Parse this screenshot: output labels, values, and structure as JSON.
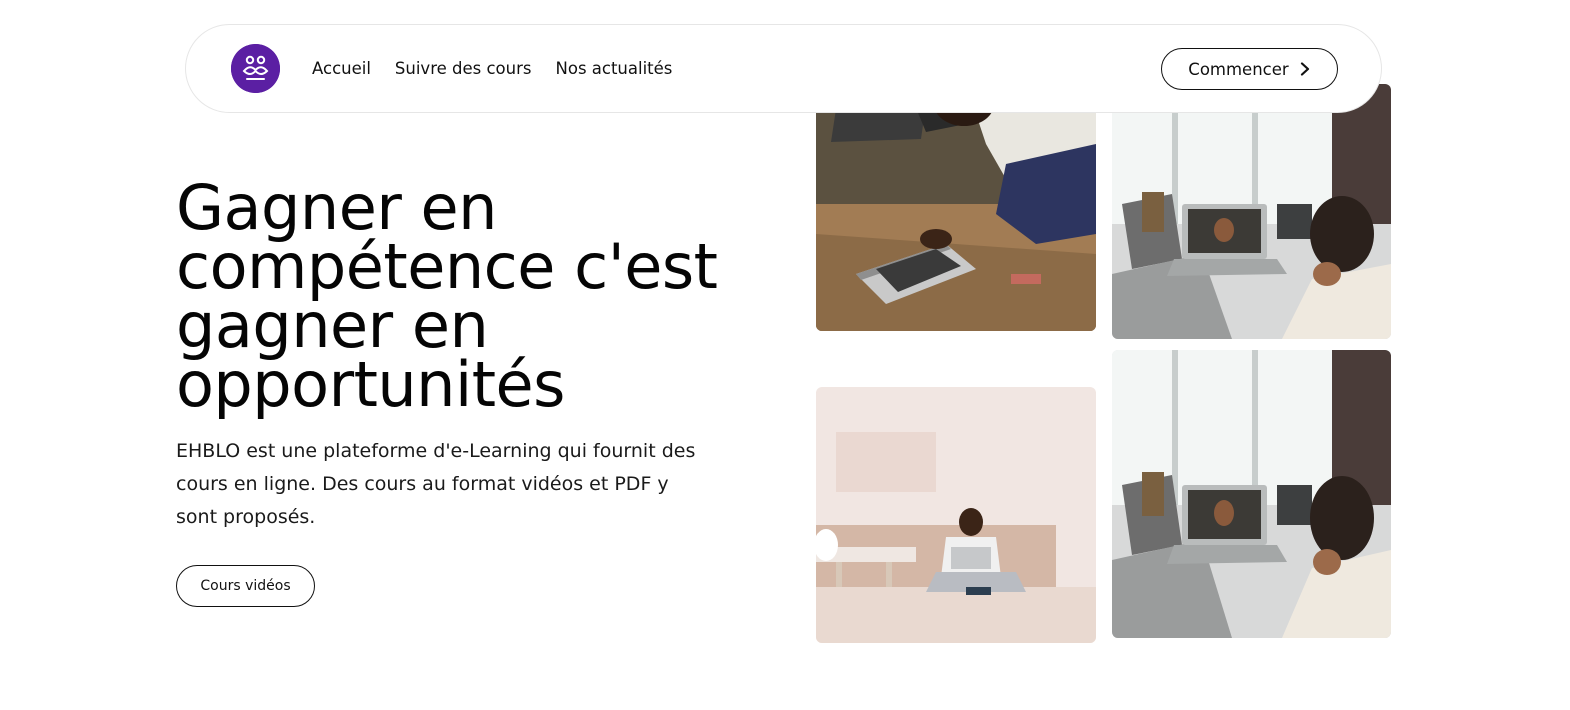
{
  "navbar": {
    "logo_icon": "ehblo-logo-icon",
    "brand_color": "#5b1fa3",
    "links": [
      {
        "label": "Accueil"
      },
      {
        "label": "Suivre des cours"
      },
      {
        "label": "Nos actualités"
      }
    ],
    "cta": {
      "label": "Commencer",
      "icon": "chevron-right-icon"
    }
  },
  "hero": {
    "title": "Gagner en compétence c'est gagner en opportunités",
    "description": "EHBLO est une plateforme d'e-Learning qui fournit des cours en ligne. Des cours au format vidéos et PDF y sont proposés.",
    "button_label": "Cours vidéos"
  },
  "gallery": {
    "photos": [
      {
        "name": "man-laptop-workbench-photo"
      },
      {
        "name": "child-video-call-photo"
      },
      {
        "name": "man-laptop-floor-photo"
      },
      {
        "name": "child-video-call-photo"
      }
    ]
  }
}
